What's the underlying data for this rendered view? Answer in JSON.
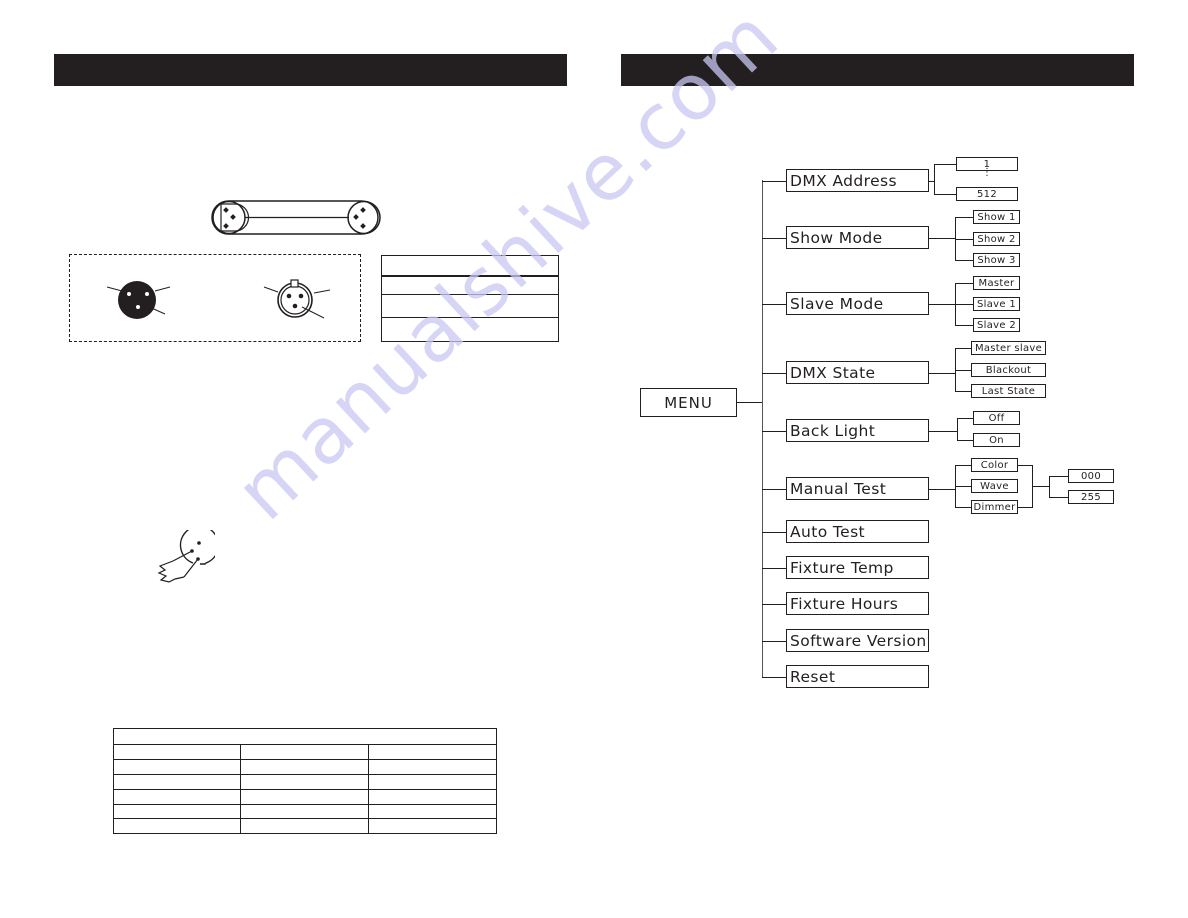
{
  "left_page": {
    "header_text": "",
    "cable_diagram": {
      "icon": "xlr-cable-icon"
    },
    "connector_male": {
      "icon": "xlr-male-connector-icon"
    },
    "connector_female": {
      "icon": "xlr-female-connector-icon"
    },
    "terminator": {
      "icon": "xlr-terminator-plug-icon"
    },
    "pin_table": {
      "rows": [
        "",
        "",
        "",
        ""
      ]
    },
    "grid_table": {
      "title": "",
      "columns": 3,
      "rows": 6
    }
  },
  "right_page": {
    "header_text": "",
    "menu": {
      "root": "MENU",
      "items": [
        {
          "label": "DMX Address",
          "children": [
            "1",
            "512"
          ],
          "range_indicator": "⋮"
        },
        {
          "label": "Show Mode",
          "children": [
            "Show 1",
            "Show 2",
            "Show 3"
          ]
        },
        {
          "label": "Slave Mode",
          "children": [
            "Master",
            "Slave 1",
            "Slave 2"
          ]
        },
        {
          "label": "DMX State",
          "children": [
            "Master slave",
            "Blackout",
            "Last State"
          ]
        },
        {
          "label": "Back Light",
          "children": [
            "Off",
            "On"
          ]
        },
        {
          "label": "Manual Test",
          "children": [
            "Color",
            "Wave",
            "Dimmer"
          ],
          "values": [
            "000",
            "255"
          ]
        },
        {
          "label": "Auto Test",
          "children": []
        },
        {
          "label": "Fixture Temp",
          "children": []
        },
        {
          "label": "Fixture Hours",
          "children": []
        },
        {
          "label": "Software Version",
          "children": []
        },
        {
          "label": "Reset",
          "children": []
        }
      ]
    }
  },
  "watermark": "manualshive.com",
  "colors": {
    "ink": "#231f20",
    "watermark": "#c9c8f2",
    "paper": "#ffffff"
  }
}
